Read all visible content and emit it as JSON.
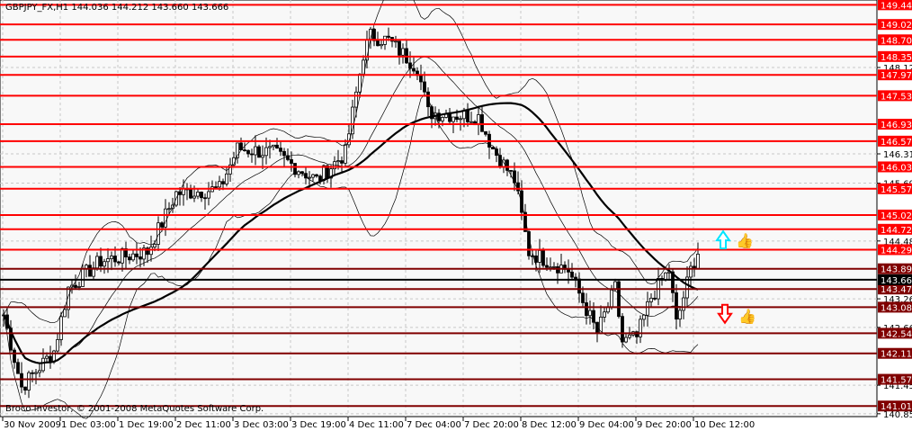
{
  "header": {
    "title": "GBPJPY_FX,H1  144.036 144.212 143.660 143.666"
  },
  "footer": {
    "copyright": "Broco Investor, © 2001-2008 MetaQuotes Software Corp."
  },
  "colors": {
    "background": "#f8f8f8",
    "resistance": "#ff0000",
    "support": "#800000",
    "current": "#000000",
    "up_arrow": "#00e5ff",
    "down_arrow": "#ff0000"
  },
  "chart_data": {
    "type": "candlestick",
    "symbol": "GBPJPY_FX",
    "timeframe": "H1",
    "ohlc_last": {
      "open": 144.036,
      "high": 144.212,
      "low": 143.66,
      "close": 143.666
    },
    "ylim": [
      140.85,
      149.48
    ],
    "bars": 194,
    "close_keypoints": [
      [
        0,
        142.93
      ],
      [
        5,
        141.41
      ],
      [
        14,
        142.17
      ],
      [
        18,
        143.49
      ],
      [
        27,
        144.06
      ],
      [
        40,
        144.25
      ],
      [
        48,
        145.48
      ],
      [
        60,
        145.57
      ],
      [
        65,
        146.42
      ],
      [
        75,
        146.33
      ],
      [
        87,
        145.76
      ],
      [
        95,
        146.33
      ],
      [
        100,
        148.41
      ],
      [
        102,
        148.79
      ],
      [
        107,
        148.69
      ],
      [
        115,
        148.125
      ],
      [
        118,
        147.18
      ],
      [
        132,
        147.09
      ],
      [
        136,
        146.42
      ],
      [
        142,
        145.76
      ],
      [
        146,
        144.25
      ],
      [
        157,
        143.87
      ],
      [
        165,
        142.55
      ],
      [
        170,
        143.49
      ],
      [
        172,
        142.36
      ],
      [
        176,
        142.45
      ],
      [
        180,
        143.3
      ],
      [
        185,
        143.87
      ],
      [
        187,
        142.74
      ],
      [
        191,
        143.87
      ],
      [
        193,
        144.25
      ],
      [
        194,
        143.67
      ]
    ],
    "x_tick_labels": [
      "30 Nov 2009",
      "1 Dec 03:00",
      "1 Dec 19:00",
      "2 Dec 11:00",
      "3 Dec 03:00",
      "3 Dec 19:00",
      "4 Dec 11:00",
      "7 Dec 04:00",
      "7 Dec 20:00",
      "8 Dec 12:00",
      "9 Dec 04:00",
      "9 Dec 20:00",
      "10 Dec 12:00"
    ],
    "bars_per_tick": 16,
    "y_tick_labels": [
      "148.125",
      "146.310",
      "145.695",
      "144.480",
      "143.265",
      "142.665",
      "141.450",
      "140.850"
    ],
    "resistance_levels": [
      "149.442",
      "149.029",
      "148.706",
      "148.355",
      "147.970",
      "147.532",
      "146.934",
      "146.578",
      "146.037",
      "145.577",
      "145.025",
      "144.726",
      "144.298"
    ],
    "support_levels": [
      "143.896",
      "143.471",
      "143.089",
      "142.541",
      "142.119",
      "141.574",
      "141.013"
    ],
    "current_price": "143.666",
    "indicators": [
      "Bollinger Bands (20, 2)",
      "Moving Average (50)"
    ],
    "annotations": [
      {
        "type": "arrow-up",
        "near_price": 144.5
      },
      {
        "type": "arrow-down",
        "near_price": 142.9
      }
    ]
  }
}
